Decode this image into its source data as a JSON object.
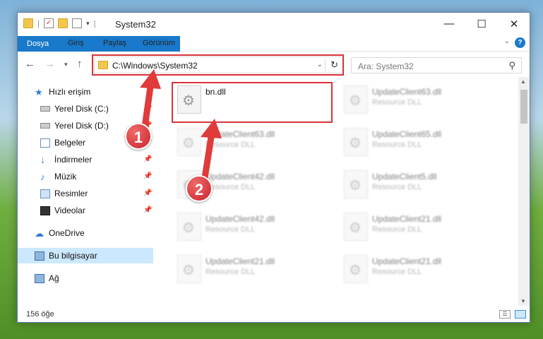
{
  "window": {
    "title": "System32"
  },
  "ribbon": {
    "tabs": [
      "Dosya",
      "Giriş",
      "Paylaş",
      "Görünüm"
    ]
  },
  "address": {
    "path": "C:\\Windows\\System32"
  },
  "search": {
    "placeholder": "Ara: System32"
  },
  "sidebar": {
    "items": [
      {
        "label": "Hızlı erişim",
        "icon": "star-icon"
      },
      {
        "label": "Yerel Disk (C:)",
        "icon": "drive-icon"
      },
      {
        "label": "Yerel Disk (D:)",
        "icon": "drive-icon"
      },
      {
        "label": "Belgeler",
        "icon": "documents-icon"
      },
      {
        "label": "İndirmeler",
        "icon": "download-icon"
      },
      {
        "label": "Müzik",
        "icon": "music-icon"
      },
      {
        "label": "Resimler",
        "icon": "pictures-icon"
      },
      {
        "label": "Videolar",
        "icon": "video-icon"
      },
      {
        "label": "OneDrive",
        "icon": "cloud-icon"
      },
      {
        "label": "Bu bilgisayar",
        "icon": "computer-icon"
      },
      {
        "label": "Ağ",
        "icon": "network-icon"
      }
    ]
  },
  "files": [
    {
      "name": "bn.dll",
      "type": ""
    },
    {
      "name": "UpdateClient63.dll",
      "type": "Resource DLL"
    },
    {
      "name": "UpdateClient63.dll",
      "type": "Resource DLL"
    },
    {
      "name": "UpdateClient65.dll",
      "type": "Resource DLL"
    },
    {
      "name": "UpdateClient42.dll",
      "type": "Resource DLL"
    },
    {
      "name": "UpdateClient5.dll",
      "type": "Resource DLL"
    },
    {
      "name": "UpdateClient42.dll",
      "type": "Resource DLL"
    },
    {
      "name": "UpdateClient21.dll",
      "type": "Resource DLL"
    },
    {
      "name": "UpdateClient21.dll",
      "type": "Resource DLL"
    },
    {
      "name": "UpdateClient21.dll",
      "type": "Resource DLL"
    }
  ],
  "status": {
    "count": "156 öğe"
  },
  "annotations": {
    "step1": "1",
    "step2": "2",
    "accent": "#d8333a"
  }
}
